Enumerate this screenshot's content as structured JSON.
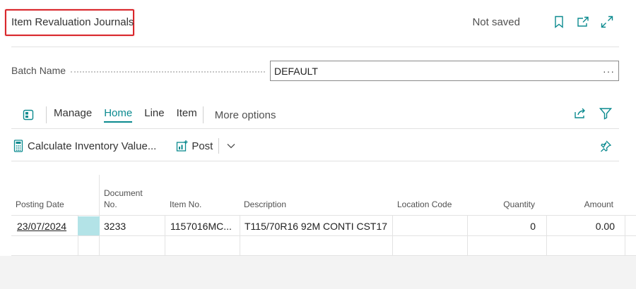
{
  "header": {
    "title": "Item Revaluation Journals",
    "status": "Not saved"
  },
  "batch": {
    "label": "Batch Name",
    "value": "DEFAULT",
    "lookup": "···"
  },
  "actions": {
    "tabs": [
      "Manage",
      "Home",
      "Line",
      "Item"
    ],
    "active_tab": "Home",
    "more": "More options"
  },
  "commands": {
    "calculate": "Calculate Inventory Value...",
    "post": "Post"
  },
  "grid": {
    "headers": {
      "posting_date": "Posting Date",
      "document_no_line1": "Document",
      "document_no_line2": "No.",
      "item_no": "Item No.",
      "description": "Description",
      "location_code": "Location Code",
      "quantity": "Quantity",
      "amount": "Amount"
    },
    "rows": [
      {
        "posting_date": "23/07/2024",
        "document_no": "3233",
        "item_no": "1157016MC...",
        "description": "T115/70R16 92M CONTI CST17",
        "location_code": "",
        "quantity": "0",
        "amount": "0.00"
      }
    ]
  },
  "colors": {
    "accent": "#0b8a8f",
    "highlight_border": "#d9262b",
    "selected_cell": "#b3e3e7"
  }
}
